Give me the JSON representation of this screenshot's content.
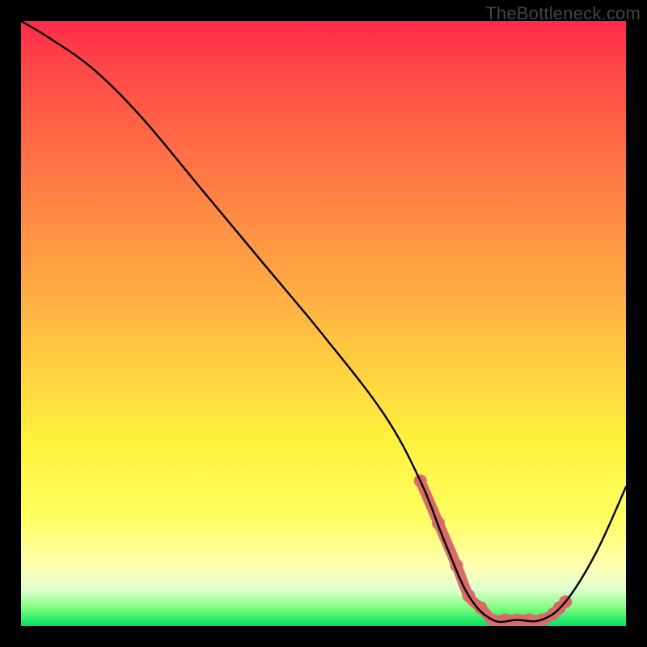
{
  "watermark": "TheBottleneck.com",
  "chart_data": {
    "type": "line",
    "title": "",
    "xlabel": "",
    "ylabel": "",
    "xlim": [
      0,
      100
    ],
    "ylim": [
      0,
      100
    ],
    "series": [
      {
        "name": "bottleneck-curve",
        "x": [
          0,
          5,
          12,
          20,
          30,
          40,
          50,
          60,
          66,
          70,
          74,
          78,
          82,
          86,
          90,
          95,
          100
        ],
        "y": [
          100,
          97,
          92,
          84,
          72,
          60,
          48,
          35,
          24,
          14,
          5,
          1,
          1,
          1,
          4,
          12,
          23
        ]
      }
    ],
    "flat_region": {
      "name": "optimal-range-highlight",
      "x": [
        66,
        69,
        72,
        74,
        76,
        78,
        80,
        82,
        84,
        86,
        88,
        89,
        90
      ],
      "y": [
        24,
        17,
        10,
        5,
        3,
        1,
        1,
        1,
        1,
        1,
        2,
        3,
        4
      ]
    },
    "colors": {
      "curve": "#000000",
      "highlight": "#d86a6a"
    }
  }
}
